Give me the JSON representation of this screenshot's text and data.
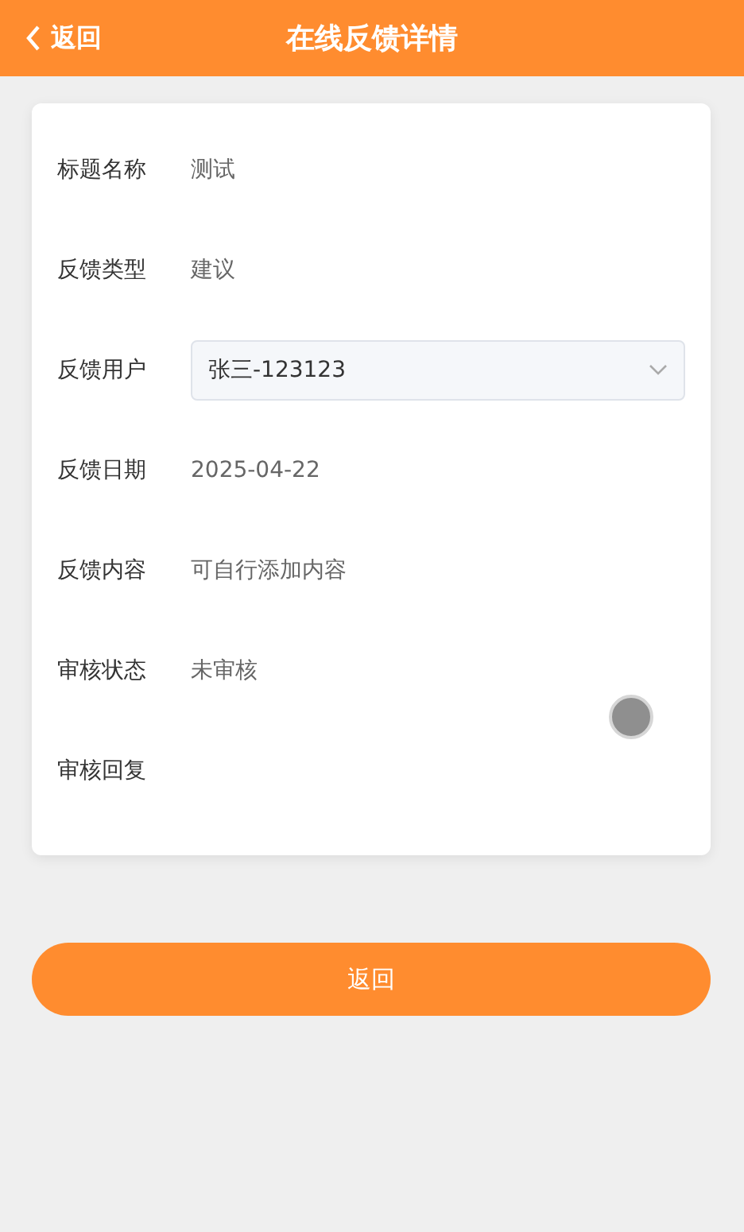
{
  "header": {
    "back_label": "返回",
    "title": "在线反馈详情"
  },
  "fields": [
    {
      "kind": "text",
      "label": "标题名称",
      "value": "测试"
    },
    {
      "kind": "text",
      "label": "反馈类型",
      "value": "建议"
    },
    {
      "kind": "select",
      "label": "反馈用户",
      "value": "张三-123123"
    },
    {
      "kind": "text",
      "label": "反馈日期",
      "value": "2025-04-22"
    },
    {
      "kind": "text",
      "label": "反馈内容",
      "value": "可自行添加内容"
    },
    {
      "kind": "text",
      "label": "审核状态",
      "value": "未审核"
    },
    {
      "kind": "text",
      "label": "审核回复"
    }
  ],
  "button": "返回"
}
